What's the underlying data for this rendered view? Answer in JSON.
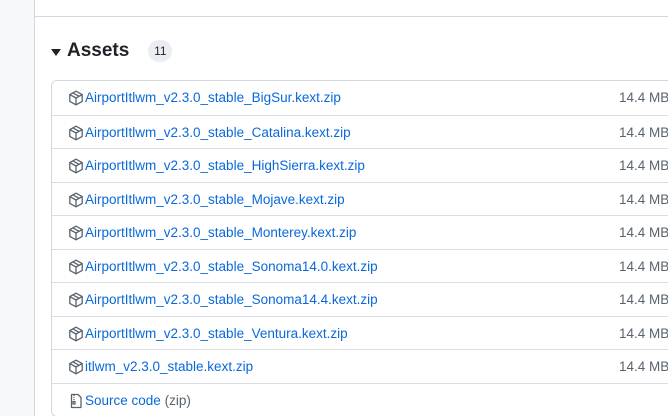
{
  "assets": {
    "title": "Assets",
    "count": "11",
    "items": [
      {
        "name": "AirportItlwm_v2.3.0_stable_BigSur.kext.zip",
        "size": "14.4 MB"
      },
      {
        "name": "AirportItlwm_v2.3.0_stable_Catalina.kext.zip",
        "size": "14.4 MB"
      },
      {
        "name": "AirportItlwm_v2.3.0_stable_HighSierra.kext.zip",
        "size": "14.4 MB"
      },
      {
        "name": "AirportItlwm_v2.3.0_stable_Mojave.kext.zip",
        "size": "14.4 MB"
      },
      {
        "name": "AirportItlwm_v2.3.0_stable_Monterey.kext.zip",
        "size": "14.4 MB"
      },
      {
        "name": "AirportItlwm_v2.3.0_stable_Sonoma14.0.kext.zip",
        "size": "14.4 MB"
      },
      {
        "name": "AirportItlwm_v2.3.0_stable_Sonoma14.4.kext.zip",
        "size": "14.4 MB"
      },
      {
        "name": "AirportItlwm_v2.3.0_stable_Ventura.kext.zip",
        "size": "14.4 MB"
      },
      {
        "name": "itlwm_v2.3.0_stable.kext.zip",
        "size": "14.4 MB"
      }
    ],
    "source_code": {
      "label": "Source code",
      "suffix": "(zip)"
    }
  },
  "icons": {
    "asset": "package-icon",
    "source": "file-zip-icon",
    "toggle": "triangle-down-icon"
  }
}
